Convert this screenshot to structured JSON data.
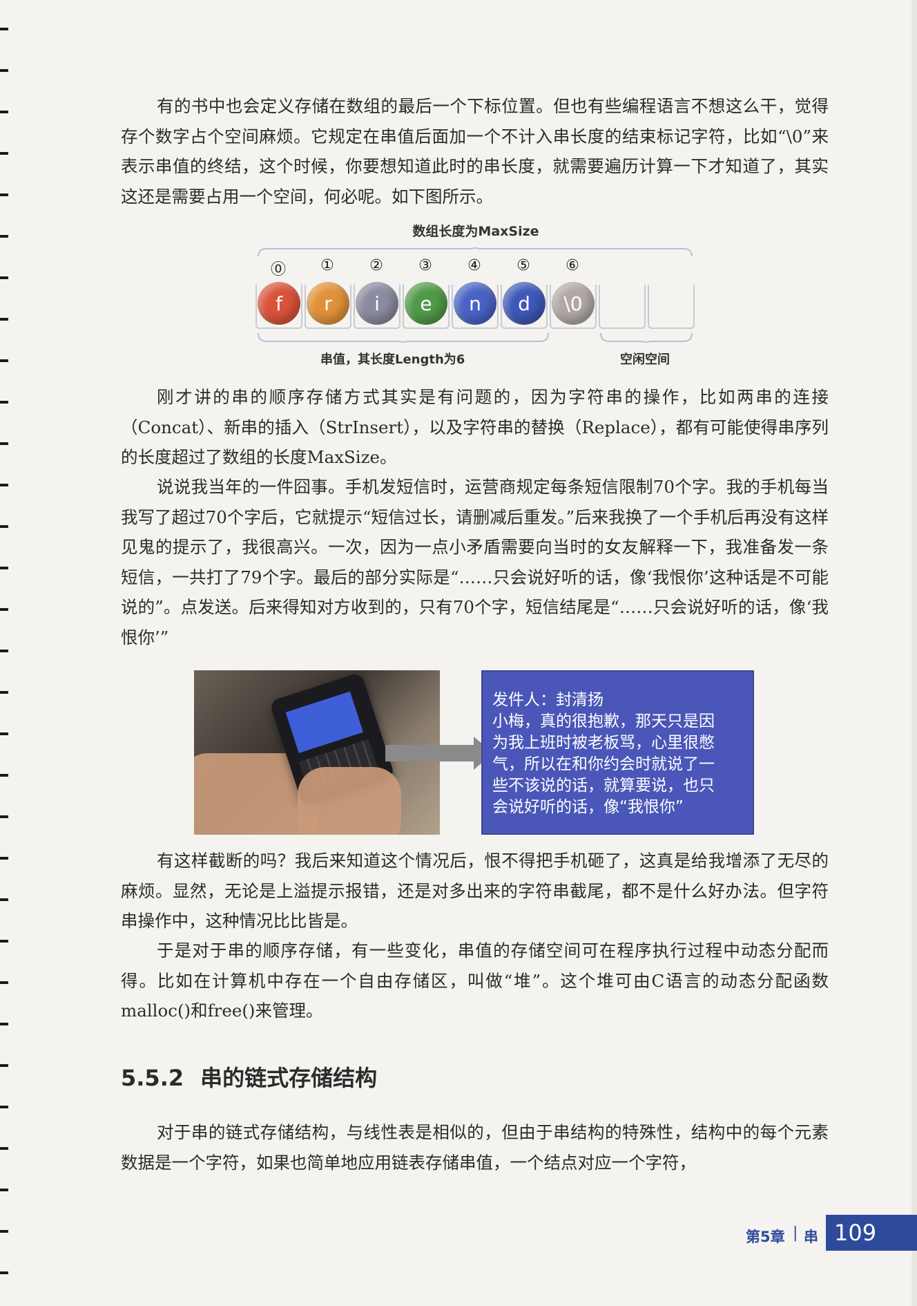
{
  "paragraphs": {
    "p1": "有的书中也会定义存储在数组的最后一个下标位置。但也有些编程语言不想这么干，觉得存个数字占个空间麻烦。它规定在串值后面加一个不计入串长度的结束标记字符，比如“\\0”来表示串值的终结，这个时候，你要想知道此时的串长度，就需要遍历计算一下才知道了，其实这还是需要占用一个空间，何必呢。如下图所示。",
    "p2": "刚才讲的串的顺序存储方式其实是有问题的，因为字符串的操作，比如两串的连接（Concat）、新串的插入（StrInsert），以及字符串的替换（Replace），都有可能使得串序列的长度超过了数组的长度MaxSize。",
    "p3": "说说我当年的一件囧事。手机发短信时，运营商规定每条短信限制70个字。我的手机每当我写了超过70个字后，它就提示“短信过长，请删减后重发。”后来我换了一个手机后再没有这样见鬼的提示了，我很高兴。一次，因为一点小矛盾需要向当时的女友解释一下，我准备发一条短信，一共打了79个字。最后的部分实际是“……只会说好听的话，像‘我恨你’这种话是不可能说的”。点发送。后来得知对方收到的，只有70个字，短信结尾是“……只会说好听的话，像‘我恨你’”",
    "p4": "有这样截断的吗？我后来知道这个情况后，恨不得把手机砸了，这真是给我增添了无尽的麻烦。显然，无论是上溢提示报错，还是对多出来的字符串截尾，都不是什么好办法。但字符串操作中，这种情况比比皆是。",
    "p5": "于是对于串的顺序存储，有一些变化，串值的存储空间可在程序执行过程中动态分配而得。比如在计算机中存在一个自由存储区，叫做“堆”。这个堆可由C语言的动态分配函数malloc()和free()来管理。",
    "p6": "对于串的链式存储结构，与线性表是相似的，但由于串结构的特殊性，结构中的每个元素数据是一个字符，如果也简单地应用链表存储串值，一个结点对应一个字符，"
  },
  "figure": {
    "title": "数组长度为MaxSize",
    "indices": [
      "⓪",
      "①",
      "②",
      "③",
      "④",
      "⑤",
      "⑥"
    ],
    "chars": [
      {
        "ch": "f",
        "color": "#d9533a"
      },
      {
        "ch": "r",
        "color": "#e0923a"
      },
      {
        "ch": "i",
        "color": "#8a8aa0"
      },
      {
        "ch": "e",
        "color": "#4f9a48"
      },
      {
        "ch": "n",
        "color": "#4a62c4"
      },
      {
        "ch": "d",
        "color": "#3f58b8"
      },
      {
        "ch": "\\0",
        "color": "#b0a8a6"
      }
    ],
    "caption_value": "串值，其长度Length为6",
    "caption_free": "空闲空间"
  },
  "sms": {
    "lines": [
      "发件人：封清扬",
      "小梅，真的很抱歉，那天只是因",
      "为我上班时被老板骂，心里很憋",
      "气，所以在和你约会时就说了一",
      "些不该说的话，就算要说，也只",
      "会说好听的话，像“我恨你”"
    ],
    "bg_color": "#4a57b8"
  },
  "section": {
    "number": "5.5.2",
    "title": "串的链式存储结构"
  },
  "footer": {
    "chapter": "第5章",
    "separator": "|",
    "chapter_title": "串",
    "page_number": "109"
  }
}
